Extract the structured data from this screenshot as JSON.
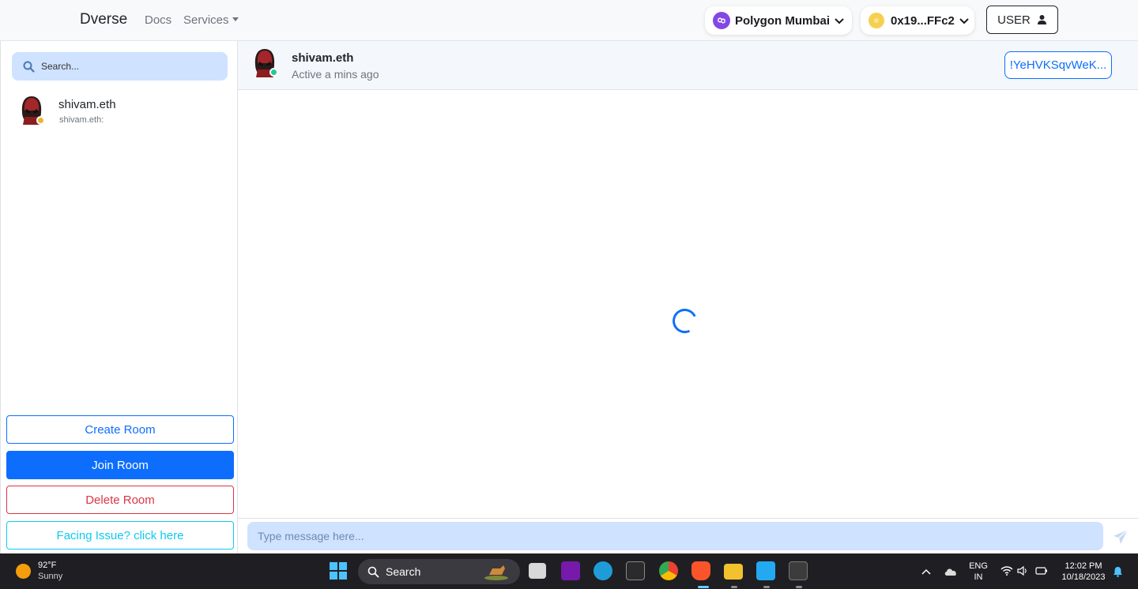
{
  "navbar": {
    "brand": "Dverse",
    "docs": "Docs",
    "services": "Services",
    "network": "Polygon Mumbai",
    "account": "0x19...FFc2",
    "user": "USER"
  },
  "sidebar": {
    "search_placeholder": "Search...",
    "contacts": [
      {
        "name": "shivam.eth",
        "preview": "shivam.eth:"
      }
    ],
    "buttons": {
      "create": "Create Room",
      "join": "Join Room",
      "delete": "Delete Room",
      "issue": "Facing Issue? click here"
    }
  },
  "chat": {
    "name": "shivam.eth",
    "status": "Active a mins ago",
    "room_id": "!YeHVKSqvWeK...",
    "input_placeholder": "Type message here..."
  },
  "taskbar": {
    "temperature": "92°F",
    "condition": "Sunny",
    "search": "Search",
    "lang_top": "ENG",
    "lang_bottom": "IN",
    "time": "12:02 PM",
    "date": "10/18/2023"
  },
  "colors": {
    "primary": "#0d6efd",
    "danger": "#dc3545",
    "info": "#0dcaf0",
    "polygon": "#8247e5",
    "search_bg": "#cfe2ff",
    "online": "#20c997",
    "away": "#f0b429"
  }
}
